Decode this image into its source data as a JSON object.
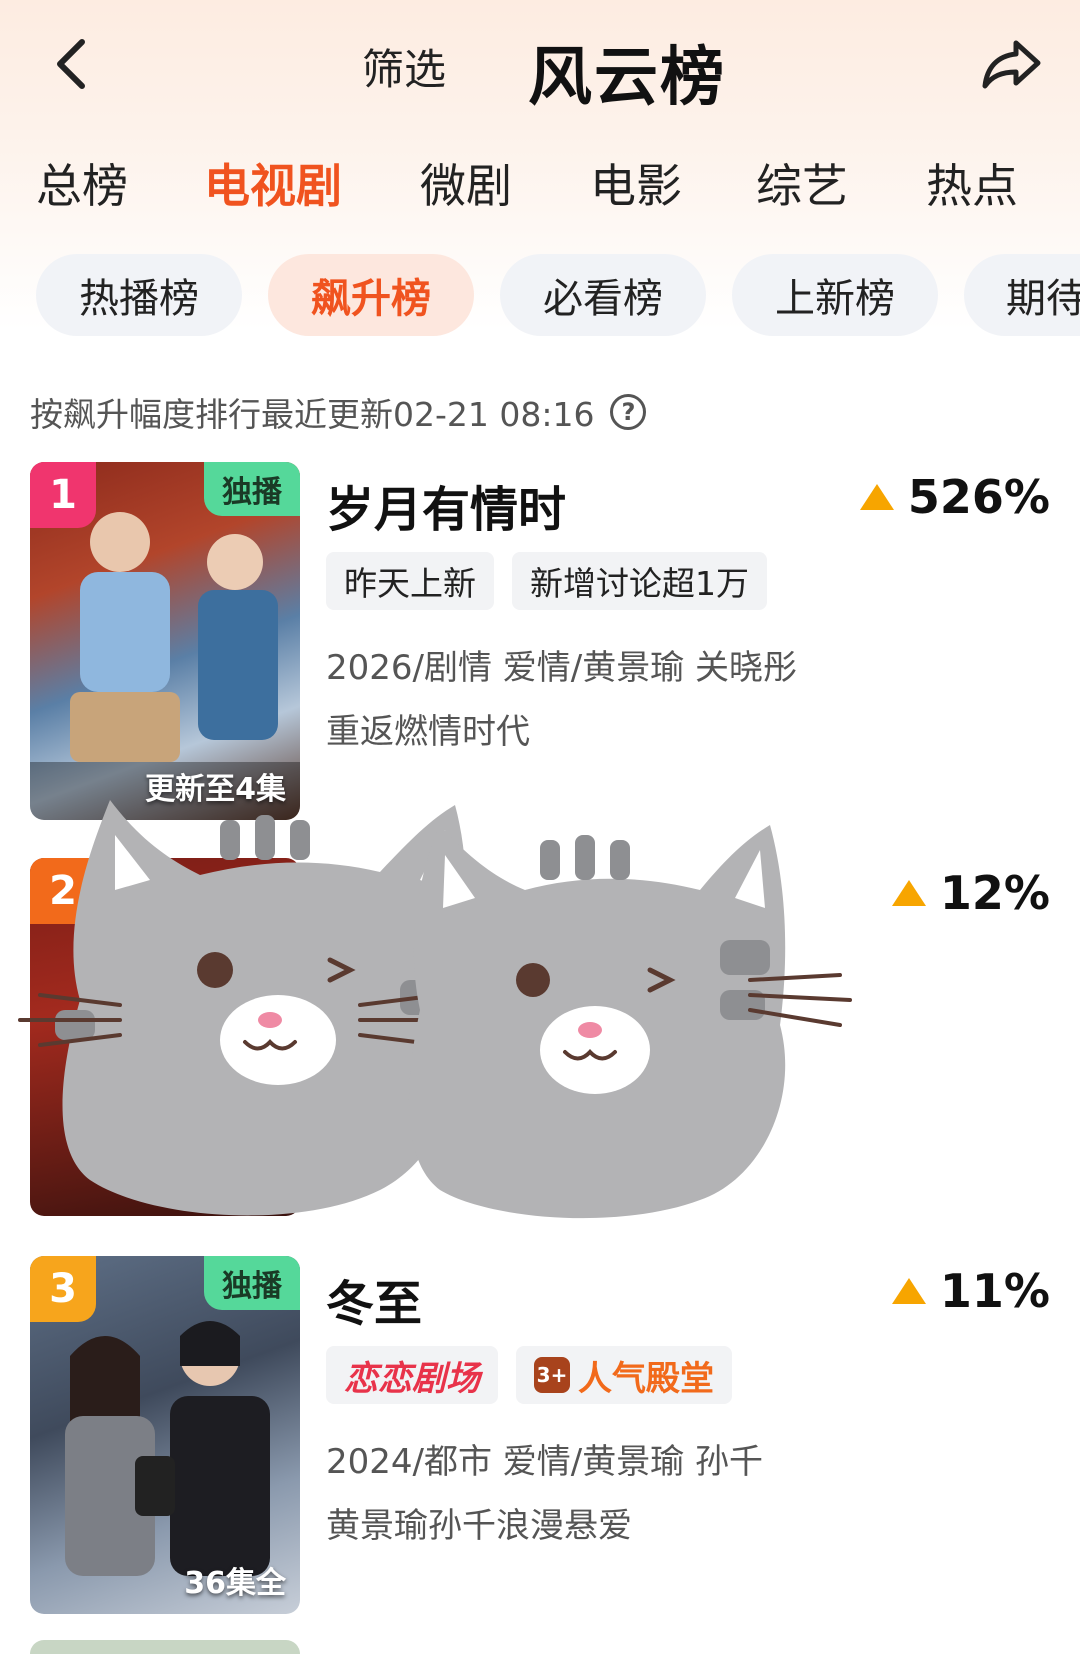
{
  "header": {
    "filter_label": "筛选",
    "title": "风云榜"
  },
  "main_tabs": [
    {
      "label": "总榜"
    },
    {
      "label": "电视剧",
      "active": true
    },
    {
      "label": "微剧"
    },
    {
      "label": "电影"
    },
    {
      "label": "综艺"
    },
    {
      "label": "热点"
    }
  ],
  "sub_tabs": [
    {
      "label": "热播榜"
    },
    {
      "label": "飙升榜",
      "active": true
    },
    {
      "label": "必看榜"
    },
    {
      "label": "上新榜"
    },
    {
      "label": "期待"
    }
  ],
  "info": {
    "text": "按飙升幅度排行最近更新02-21 08:16",
    "help_icon": "?"
  },
  "items": [
    {
      "rank": "1",
      "rank_color": "#f0356e",
      "exclusive": "独播",
      "episodes": "更新至4集",
      "title": "岁月有情时",
      "trend": "526%",
      "tags": [
        "昨天上新",
        "新增讨论超1万"
      ],
      "meta": "2026/剧情 爱情/黄景瑜 关晓彤",
      "desc": "重返燃情时代"
    },
    {
      "rank": "2",
      "rank_color": "#f26a1b",
      "trend": "12%"
    },
    {
      "rank": "3",
      "rank_color": "#f7a51c",
      "exclusive": "独播",
      "episodes": "36集全",
      "title": "冬至",
      "trend": "11%",
      "brand_tags": [
        "恋恋剧场",
        "人气殿堂"
      ],
      "brand_icon": "3+",
      "meta": "2024/都市 爱情/黄景瑜 孙千",
      "desc": "黄景瑜孙千浪漫悬爱"
    }
  ],
  "colors": {
    "accent": "#f0531f",
    "trend_up": "#f7a500",
    "exclusive_badge": "#55d89a"
  },
  "icons": {
    "back": "chevron-left-icon",
    "share": "share-arrow-icon",
    "help": "question-circle-icon",
    "trend": "triangle-up-icon"
  }
}
